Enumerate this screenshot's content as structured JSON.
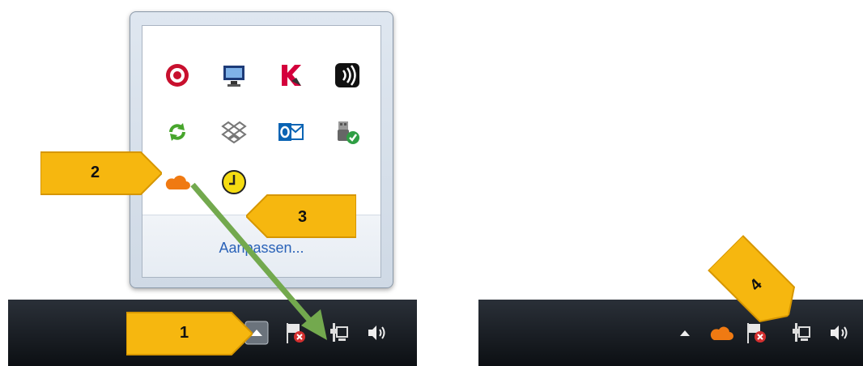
{
  "tray_popup": {
    "customize_label": "Aanpassen..."
  },
  "callouts": {
    "c1": "1",
    "c2": "2",
    "c3": "3",
    "c4": "4"
  },
  "colors": {
    "callout_yellow": "#f6b70f",
    "arrow_green": "#73a94e",
    "taskbar_dark": "#111418",
    "link_blue": "#2a62b8"
  },
  "icons": {
    "popup_row1": [
      "app-red-circle-icon",
      "remote-desktop-icon",
      "antivirus-k-icon",
      "speech-waves-icon"
    ],
    "popup_row2": [
      "sync-arrows-icon",
      "dropbox-icon",
      "outlook-icon",
      "usb-device-ok-icon"
    ],
    "popup_row3": [
      "cloud-icon",
      "clock-icon"
    ],
    "taskbar_left": [
      "show-hidden-icons-button",
      "action-center-flag-icon",
      "network-icon",
      "volume-icon"
    ],
    "taskbar_right": [
      "show-hidden-icons-arrow",
      "cloud-icon",
      "action-center-flag-icon",
      "network-icon",
      "volume-icon"
    ]
  }
}
